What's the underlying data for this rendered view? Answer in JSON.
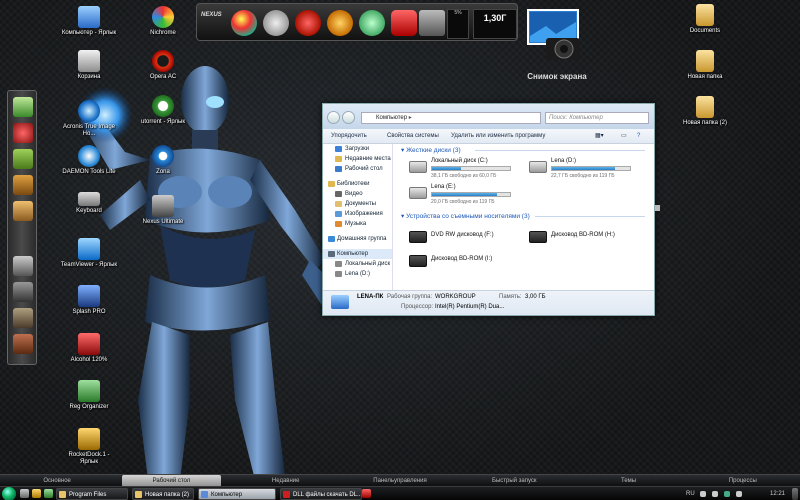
{
  "desktop_icons": [
    {
      "id": "computer",
      "label": "Компьютер - Ярлык",
      "color": "#4a8ad8"
    },
    {
      "id": "recycle",
      "label": "Корзина",
      "color": "#c9c9c9"
    },
    {
      "id": "acronis",
      "label": "Acronis True Image Ho...",
      "color": "#3a7cc4"
    },
    {
      "id": "daemon",
      "label": "DAEMON Tools Lite",
      "color": "#3aa0e0"
    },
    {
      "id": "keyboard",
      "label": "Keyboard",
      "color": "#888888"
    },
    {
      "id": "teamviewer",
      "label": "TeamViewer - Ярлык",
      "color": "#1a8fd8"
    },
    {
      "id": "splash",
      "label": "Splash PRO",
      "color": "#2a5fa8"
    },
    {
      "id": "alcohol",
      "label": "Alcohol 120%",
      "color": "#d83030"
    },
    {
      "id": "regorg",
      "label": "Reg Organizer",
      "color": "#3b9a3b"
    },
    {
      "id": "rocketdock",
      "label": "RocketDock.1 - Ярлык",
      "color": "#d8a020"
    },
    {
      "id": "nichrome",
      "label": "Nichrome",
      "color": "#d84040"
    },
    {
      "id": "operaac",
      "label": "Opera AC",
      "color": "#cc1f1f"
    },
    {
      "id": "utorrent",
      "label": "utorrent - Ярлык",
      "color": "#3b9a3b"
    },
    {
      "id": "zona",
      "label": "Zona",
      "color": "#2a8ad8"
    },
    {
      "id": "nexus",
      "label": "Nexus Ultimate",
      "color": "#777777"
    },
    {
      "id": "documents",
      "label": "Documents",
      "color": "#e8c468"
    },
    {
      "id": "newfolder",
      "label": "Новая папка",
      "color": "#e8c468"
    },
    {
      "id": "newfolder2",
      "label": "Новая папка (2)",
      "color": "#e8c468"
    }
  ],
  "dock": {
    "nexus_label": "NEXUS",
    "cpu_label": "5%",
    "ram_label": "1,30Г"
  },
  "screenshot_widget": {
    "label": "Снимок экрана"
  },
  "explorer": {
    "address": "Компьютер",
    "search_placeholder": "Поиск: Компьютер",
    "toolbar": {
      "organize": "Упорядочить",
      "system_props": "Свойства системы",
      "uninstall": "Удалить или изменить программу"
    },
    "sidebar": [
      {
        "label": "Загрузки",
        "type": "item",
        "color": "#3b82d8"
      },
      {
        "label": "Недавние места",
        "type": "item",
        "color": "#e0b850"
      },
      {
        "label": "Рабочий стол",
        "type": "item",
        "color": "#3b7cc8"
      },
      {
        "label": "",
        "type": "spacer"
      },
      {
        "label": "Библиотеки",
        "type": "head",
        "color": "#e0b850"
      },
      {
        "label": "Видео",
        "type": "item",
        "color": "#666666"
      },
      {
        "label": "Документы",
        "type": "item",
        "color": "#e0c070"
      },
      {
        "label": "Изображения",
        "type": "item",
        "color": "#5a9ad8"
      },
      {
        "label": "Музыка",
        "type": "item",
        "color": "#e08a30"
      },
      {
        "label": "",
        "type": "spacer"
      },
      {
        "label": "Домашняя группа",
        "type": "head",
        "color": "#3b8ad8"
      },
      {
        "label": "",
        "type": "spacer"
      },
      {
        "label": "Компьютер",
        "type": "head-sel",
        "color": "#5a6a7a"
      },
      {
        "label": "Локальный диск",
        "type": "item",
        "color": "#888888"
      },
      {
        "label": "Lena (D:)",
        "type": "item",
        "color": "#888888"
      }
    ],
    "hard_drives_header": "Жесткие диски (3)",
    "drives": [
      {
        "name": "Локальный диск (C:)",
        "free": "38,1 ГБ свободно из 60,0 ГБ",
        "used": 0.37
      },
      {
        "name": "Lena (D:)",
        "free": "22,7 ГБ свободно из 119 ГБ",
        "used": 0.81
      },
      {
        "name": "Lena (E:)",
        "free": "20,0 ГБ свободно из 119 ГБ",
        "used": 0.83
      }
    ],
    "removable_header": "Устройства со съемными носителями (3)",
    "removable": [
      {
        "name": "DVD RW дисковод (F:)"
      },
      {
        "name": "Дисковод BD-ROM (H:)"
      },
      {
        "name": "Дисковод BD-ROM (I:)"
      }
    ],
    "status": {
      "pc_name": "LENA-ПК",
      "workgroup_label": "Рабочая группа:",
      "workgroup": "WORKGROUP",
      "memory_label": "Память:",
      "memory": "3,00 ГБ",
      "processor_label": "Процессор:",
      "processor": "Intel(R) Pentium(R) Dua..."
    }
  },
  "bottom_panel": [
    {
      "label": "Основное",
      "active": false
    },
    {
      "label": "Рабочий стол",
      "active": true
    },
    {
      "label": "Недавние",
      "active": false
    },
    {
      "label": "Панельуправления",
      "active": false
    },
    {
      "label": "Быстрый запуск",
      "active": false
    },
    {
      "label": "Темы",
      "active": false
    },
    {
      "label": "Процессы",
      "active": false
    }
  ],
  "taskbar": {
    "tasks": [
      {
        "label": "Program Files",
        "icon": "#e8c468",
        "active": false
      },
      {
        "label": "Новая папка (2)",
        "icon": "#e8c468",
        "active": false
      },
      {
        "label": "Компьютер",
        "icon": "#5a8ad8",
        "active": true
      },
      {
        "label": "DLL файлы скачать DL...",
        "icon": "#cc1f1f",
        "active": false
      }
    ],
    "language": "RU",
    "clock": "12:21"
  }
}
